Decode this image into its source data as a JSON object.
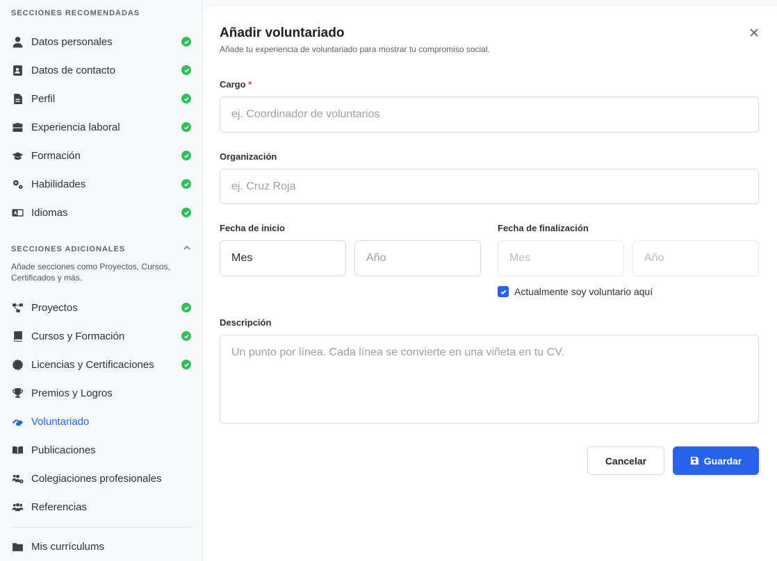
{
  "sidebar": {
    "recommended_title": "SECCIONES RECOMENDADAS",
    "recommended": [
      {
        "label": "Datos personales",
        "icon": "user-icon",
        "done": true
      },
      {
        "label": "Datos de contacto",
        "icon": "contact-card-icon",
        "done": true
      },
      {
        "label": "Perfil",
        "icon": "document-icon",
        "done": true
      },
      {
        "label": "Experiencia laboral",
        "icon": "briefcase-icon",
        "done": true
      },
      {
        "label": "Formación",
        "icon": "graduation-cap-icon",
        "done": true
      },
      {
        "label": "Habilidades",
        "icon": "gears-icon",
        "done": true
      },
      {
        "label": "Idiomas",
        "icon": "language-icon",
        "done": true
      }
    ],
    "additional_title": "SECCIONES ADICIONALES",
    "additional_desc": "Añade secciones como Proyectos, Cursos, Certificados y más.",
    "additional": [
      {
        "label": "Proyectos",
        "icon": "project-diagram-icon",
        "done": true
      },
      {
        "label": "Cursos y Formación",
        "icon": "book-icon",
        "done": true
      },
      {
        "label": "Licencias y Certificaciones",
        "icon": "certificate-icon",
        "done": true
      },
      {
        "label": "Premios y Logros",
        "icon": "trophy-icon",
        "done": false
      },
      {
        "label": "Voluntariado",
        "icon": "hands-helping-icon",
        "done": false,
        "active": true
      },
      {
        "label": "Publicaciones",
        "icon": "open-book-icon",
        "done": false
      },
      {
        "label": "Colegiaciones profesionales",
        "icon": "users-cog-icon",
        "done": false
      },
      {
        "label": "Referencias",
        "icon": "users-icon",
        "done": false
      }
    ],
    "footer_item": {
      "label": "Mis currículums",
      "icon": "folder-icon"
    }
  },
  "modal": {
    "title": "Añadir voluntariado",
    "subtitle": "Añade tu experiencia de voluntariado para mostrar tu compromiso social.",
    "cargo_label": "Cargo",
    "required_mark": "*",
    "cargo_placeholder": "ej. Coordinador de voluntarios",
    "org_label": "Organización",
    "org_placeholder": "ej. Cruz Roja",
    "start_label": "Fecha de inicio",
    "start_month": "Mes",
    "start_year_placeholder": "Año",
    "end_label": "Fecha de finalización",
    "end_month_placeholder": "Mes",
    "end_year_placeholder": "Año",
    "current_label": "Actualmente soy voluntario aquí",
    "current_checked": true,
    "desc_label": "Descripción",
    "desc_placeholder": "Un punto por línea. Cada línea se convierte en una viñeta en tu CV.",
    "cancel_label": "Cancelar",
    "save_label": "Guardar"
  },
  "colors": {
    "accent": "#2563eb",
    "success": "#2fbf5b",
    "required": "#e03a3a"
  }
}
